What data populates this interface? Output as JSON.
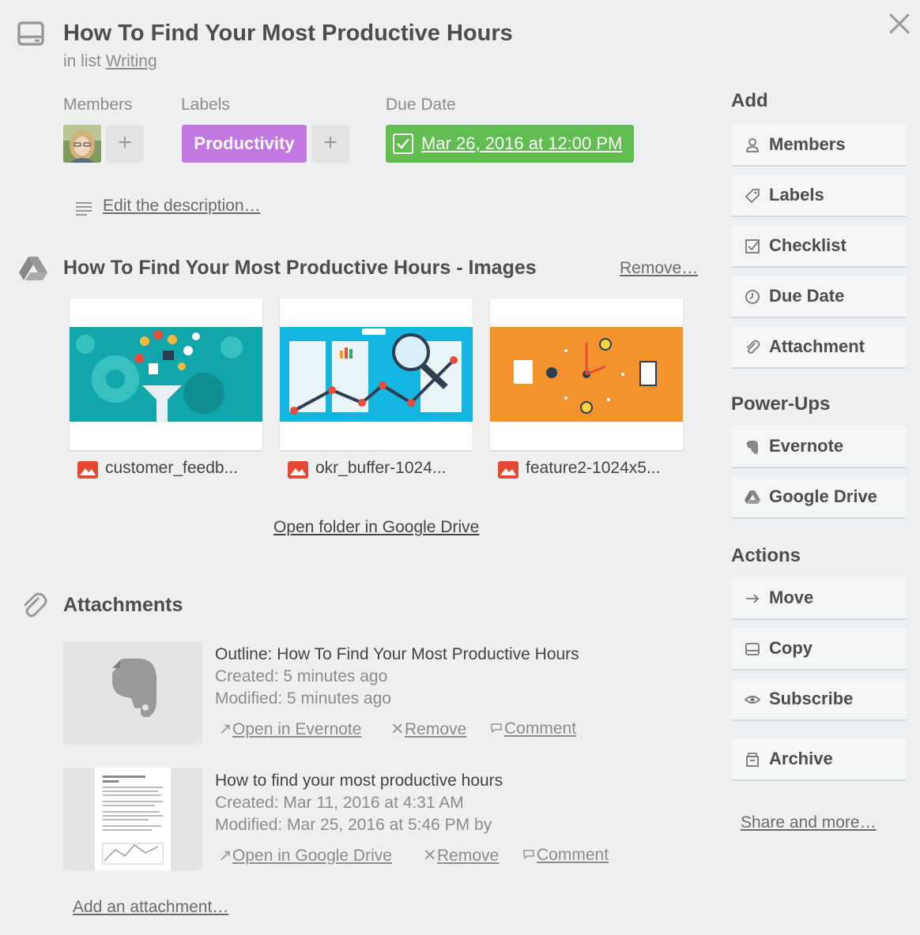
{
  "card": {
    "title": "How To Find Your Most Productive Hours",
    "in_list_prefix": "in list",
    "list_name": "Writing"
  },
  "members": {
    "label": "Members",
    "add": "+"
  },
  "labels": {
    "label": "Labels",
    "chip": "Productivity",
    "chip_color": "#c377e0",
    "add": "+"
  },
  "due_date": {
    "label": "Due Date",
    "value": "Mar 26, 2016 at 12:00 PM",
    "complete": true,
    "color": "#61bd4f"
  },
  "description": {
    "link": "Edit the description…"
  },
  "drive": {
    "title": "How To Find Your Most Productive Hours - Images",
    "remove": "Remove…",
    "files": [
      {
        "name": "customer_feedb...",
        "theme": "teal"
      },
      {
        "name": "okr_buffer-1024...",
        "theme": "blue"
      },
      {
        "name": "feature2-1024x5...",
        "theme": "orange"
      }
    ],
    "open_folder": "Open folder in Google Drive"
  },
  "attachments": {
    "title": "Attachments",
    "items": [
      {
        "name": "Outline: How To Find Your Most Productive Hours",
        "created": "Created: 5 minutes ago",
        "modified": "Modified: 5 minutes ago",
        "open": "Open in Evernote",
        "remove": "Remove",
        "comment": "Comment",
        "thumb_icon": "evernote-elephant-icon"
      },
      {
        "name": "How to find your most productive hours",
        "created": "Created: Mar 11, 2016 at 4:31 AM",
        "modified": "Modified: Mar 25, 2016 at 5:46 PM by",
        "open": "Open in Google Drive",
        "remove": "Remove",
        "comment": "Comment",
        "thumb_icon": "document-preview"
      }
    ],
    "add": "Add an attachment…"
  },
  "sidebar": {
    "add_heading": "Add",
    "add_buttons": [
      {
        "label": "Members",
        "icon": "person-icon"
      },
      {
        "label": "Labels",
        "icon": "tag-icon"
      },
      {
        "label": "Checklist",
        "icon": "checkbox-icon"
      },
      {
        "label": "Due Date",
        "icon": "clock-icon"
      },
      {
        "label": "Attachment",
        "icon": "paperclip-icon"
      }
    ],
    "powerups_heading": "Power-Ups",
    "powerup_buttons": [
      {
        "label": "Evernote",
        "icon": "evernote-icon"
      },
      {
        "label": "Google Drive",
        "icon": "google-drive-icon"
      }
    ],
    "actions_heading": "Actions",
    "action_buttons": [
      {
        "label": "Move",
        "icon": "arrow-right-icon"
      },
      {
        "label": "Copy",
        "icon": "card-icon"
      },
      {
        "label": "Subscribe",
        "icon": "eye-icon"
      },
      {
        "label": "Archive",
        "icon": "archive-icon"
      }
    ],
    "share": "Share and more…"
  }
}
